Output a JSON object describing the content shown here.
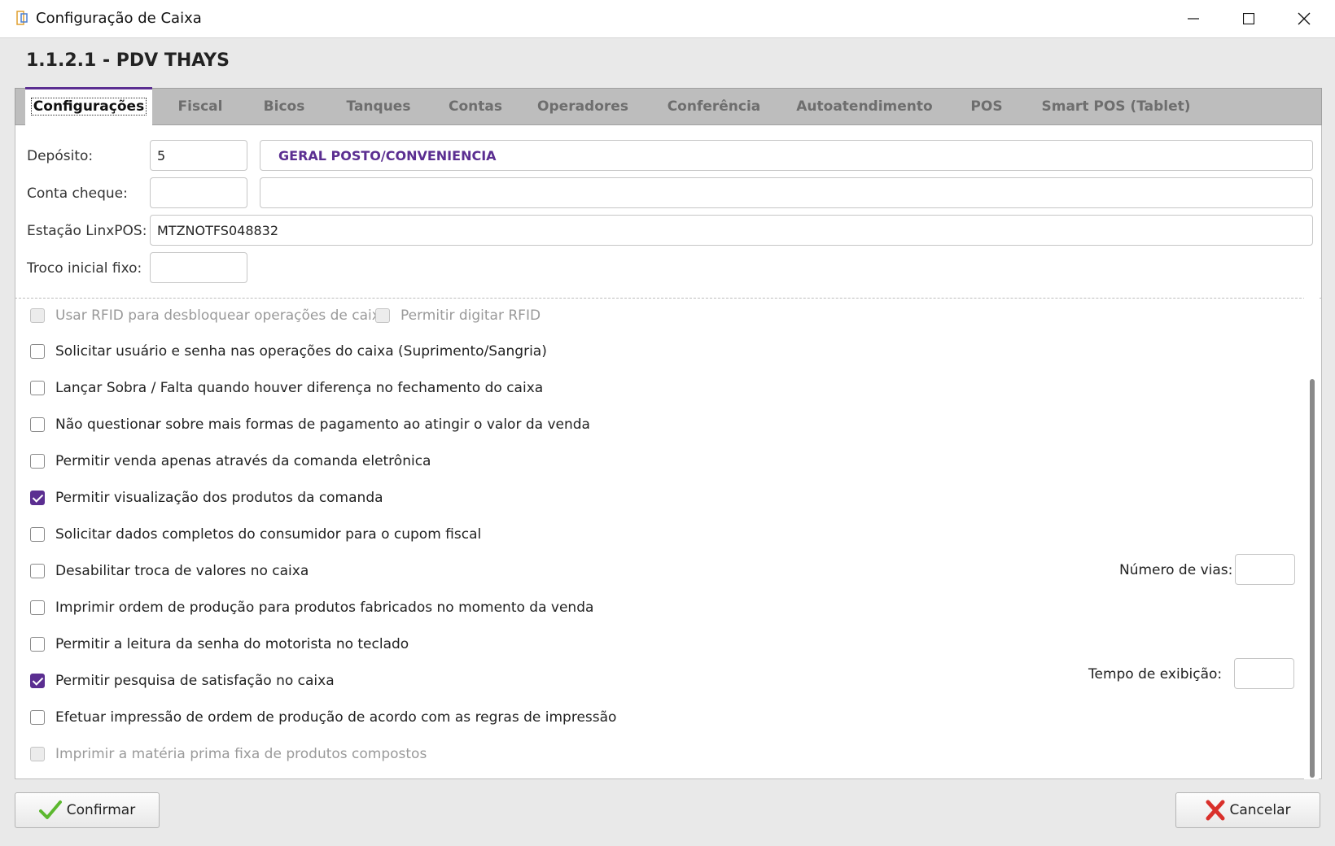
{
  "window": {
    "title": "Configuração de Caixa",
    "minimize_glyph": "—",
    "maximize_glyph": "☐",
    "close_glyph": "✕"
  },
  "header": {
    "title": "1.1.2.1 - PDV THAYS"
  },
  "tabs": [
    {
      "label": "Configurações",
      "active": true
    },
    {
      "label": "Fiscal"
    },
    {
      "label": "Bicos"
    },
    {
      "label": "Tanques"
    },
    {
      "label": "Contas"
    },
    {
      "label": "Operadores"
    },
    {
      "label": "Conferência"
    },
    {
      "label": "Autoatendimento"
    },
    {
      "label": "POS"
    },
    {
      "label": "Smart POS (Tablet)"
    }
  ],
  "form": {
    "deposito_label": "Depósito:",
    "deposito_code": "5",
    "deposito_desc": "GERAL POSTO/CONVENIENCIA",
    "conta_cheque_label": "Conta cheque:",
    "conta_cheque_code": "",
    "conta_cheque_desc": "",
    "estacao_label": "Estação LinxPOS:",
    "estacao_value": "MTZNOTFS048832",
    "troco_label": "Troco inicial fixo:",
    "troco_value": ""
  },
  "checks": [
    {
      "label": "Usar RFID para desbloquear operações de caixa",
      "checked": false,
      "disabled": true
    },
    {
      "label": "Permitir digitar RFID",
      "checked": false,
      "disabled": true
    },
    {
      "label": "Solicitar usuário e senha nas operações do caixa (Suprimento/Sangria)",
      "checked": false
    },
    {
      "label": "Lançar Sobra / Falta quando houver diferença no fechamento do caixa",
      "checked": false
    },
    {
      "label": "Não questionar sobre mais formas de pagamento ao atingir o valor da venda",
      "checked": false
    },
    {
      "label": "Permitir venda apenas através da comanda eletrônica",
      "checked": false
    },
    {
      "label": "Permitir visualização dos produtos da comanda",
      "checked": true
    },
    {
      "label": "Solicitar dados completos do consumidor para o cupom fiscal",
      "checked": false
    },
    {
      "label": "Desabilitar troca de valores no caixa",
      "checked": false
    },
    {
      "label": "Imprimir ordem de produção para produtos fabricados no momento da venda",
      "checked": false
    },
    {
      "label": "Permitir a leitura da senha do motorista no teclado",
      "checked": false
    },
    {
      "label": "Permitir pesquisa de satisfação no caixa",
      "checked": true
    },
    {
      "label": "Efetuar impressão de ordem de produção de acordo com as regras de impressão",
      "checked": false
    },
    {
      "label": "Imprimir a matéria prima fixa de produtos compostos",
      "checked": false,
      "disabled": true
    }
  ],
  "side": {
    "numero_vias_label": "Número de vias:",
    "tempo_exibicao_label": "Tempo de exibição:"
  },
  "buttons": {
    "confirm": "Confirmar",
    "cancel": "Cancelar"
  },
  "colors": {
    "accent": "#5b2e91",
    "confirm_icon": "#5cb82f",
    "cancel_icon": "#d9302b"
  }
}
